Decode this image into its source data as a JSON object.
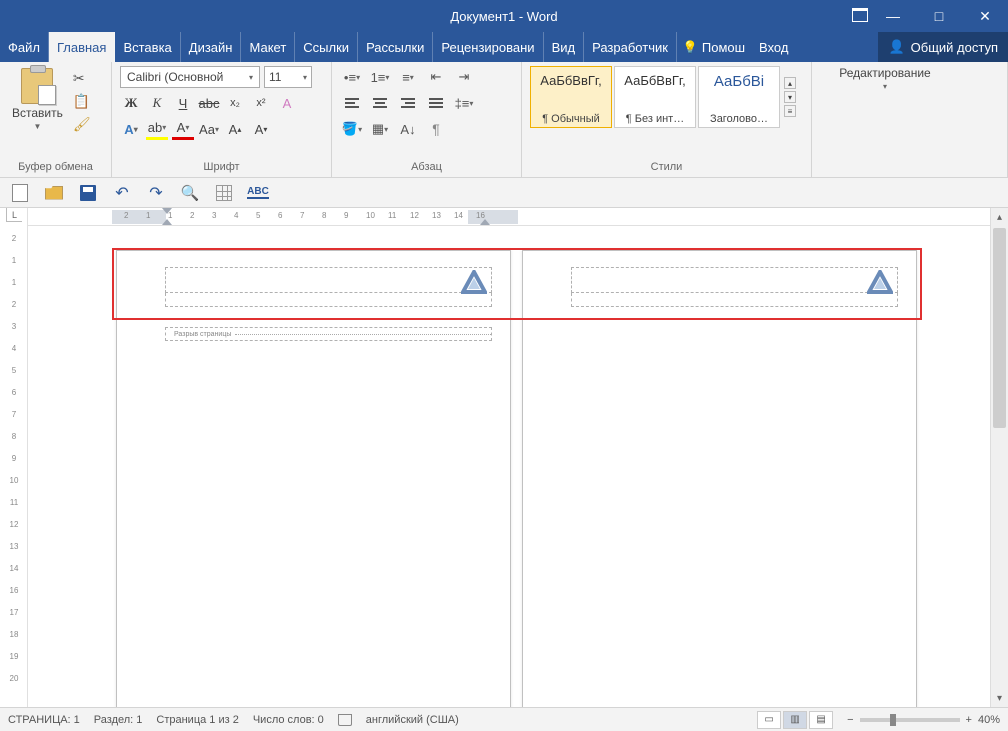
{
  "title": "Документ1 - Word",
  "window_buttons": {
    "minimize": "—",
    "maximize": "□",
    "close": "✕"
  },
  "tabs": {
    "file": "Файл",
    "home": "Главная",
    "insert": "Вставка",
    "design": "Дизайн",
    "layout": "Макет",
    "references": "Ссылки",
    "mailings": "Рассылки",
    "review": "Рецензировани",
    "view": "Вид",
    "developer": "Разработчик",
    "help": "Помош",
    "account": "Вход",
    "share": "Общий доступ"
  },
  "ribbon": {
    "clipboard": {
      "paste": "Вставить",
      "label": "Буфер обмена"
    },
    "font": {
      "name": "Calibri (Основной",
      "size": "11",
      "bold": "Ж",
      "italic": "К",
      "underline": "Ч",
      "strike": "abc",
      "sub": "x₂",
      "sup": "x²",
      "label": "Шрифт"
    },
    "paragraph": {
      "label": "Абзац"
    },
    "styles": {
      "items": [
        {
          "preview": "АаБбВвГг,",
          "name": "¶ Обычный"
        },
        {
          "preview": "АаБбВвГг,",
          "name": "¶ Без инт…"
        },
        {
          "preview": "АаБбВі",
          "name": "Заголово…"
        }
      ],
      "label": "Стили"
    },
    "editing": {
      "label": "Редактирование"
    }
  },
  "qat": {
    "abc": "ABC"
  },
  "ruler": {
    "corner": "L",
    "h_numbers": [
      "2",
      "1",
      "1",
      "2",
      "3",
      "4",
      "5",
      "6",
      "7",
      "8",
      "9",
      "10",
      "11",
      "12",
      "13",
      "14",
      "16"
    ],
    "v_numbers": [
      "2",
      "1",
      "1",
      "2",
      "3",
      "4",
      "5",
      "6",
      "7",
      "8",
      "9",
      "10",
      "11",
      "12",
      "13",
      "14",
      "16",
      "17",
      "18",
      "19",
      "20"
    ]
  },
  "document": {
    "page_break": "Разрыв страницы"
  },
  "status": {
    "page": "СТРАНИЦА: 1",
    "section": "Раздел: 1",
    "page_of": "Страница 1 из 2",
    "words": "Число слов: 0",
    "language": "английский (США)",
    "zoom": "40%"
  }
}
